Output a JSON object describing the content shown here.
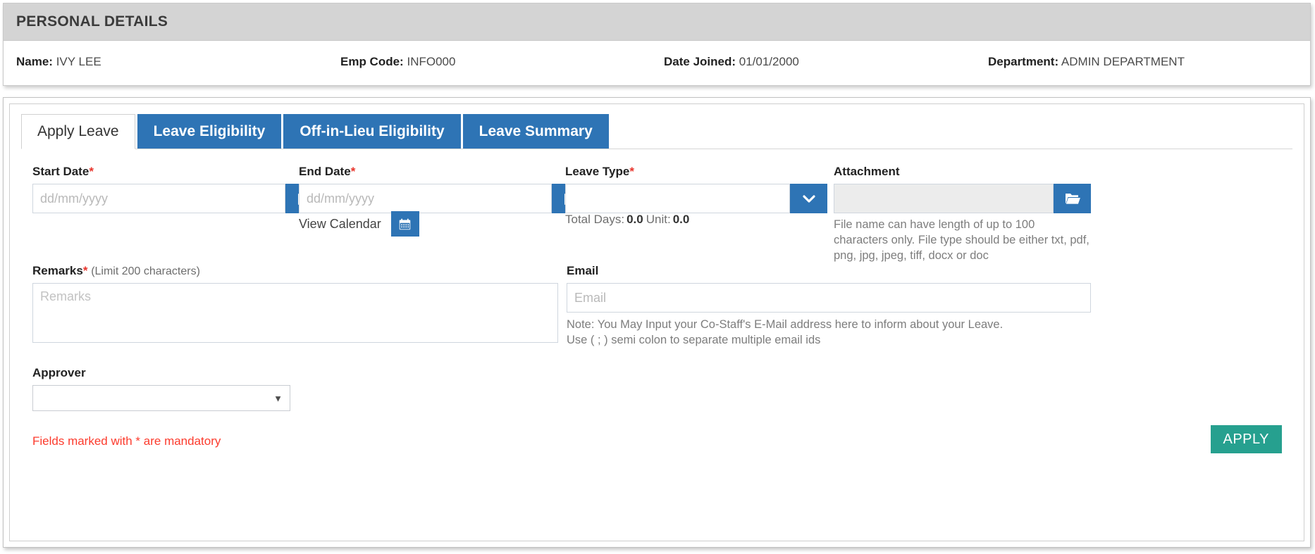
{
  "personal_details": {
    "title": "PERSONAL DETAILS",
    "fields": [
      {
        "label": "Name:",
        "value": "IVY LEE"
      },
      {
        "label": "Emp Code:",
        "value": "INFO000"
      },
      {
        "label": "Date Joined:",
        "value": "01/01/2000"
      },
      {
        "label": "Department:",
        "value": "ADMIN DEPARTMENT"
      }
    ]
  },
  "tabs": [
    {
      "label": "Apply Leave",
      "active": true
    },
    {
      "label": "Leave Eligibility",
      "active": false
    },
    {
      "label": "Off-in-Lieu Eligibility",
      "active": false
    },
    {
      "label": "Leave Summary",
      "active": false
    }
  ],
  "form": {
    "start_date": {
      "label": "Start Date",
      "required_mark": "*",
      "value": "",
      "placeholder": "dd/mm/yyyy",
      "button_icon": "calendar-icon"
    },
    "end_date": {
      "label": "End Date",
      "required_mark": "*",
      "value": "",
      "placeholder": "dd/mm/yyyy",
      "button_icon": "calendar-icon"
    },
    "view_calendar": {
      "label": "View Calendar",
      "button_icon": "calendar-icon"
    },
    "leave_type": {
      "label": "Leave Type",
      "required_mark": "*",
      "value": "",
      "button_icon": "chevron-down-icon"
    },
    "totals": {
      "total_days_label": "Total Days:",
      "total_days_value": "0.0",
      "unit_label": "Unit:",
      "unit_value": "0.0"
    },
    "attachment": {
      "label": "Attachment",
      "value": "",
      "button_icon": "folder-open-icon",
      "help_text": "File name can have length of up to 100 characters only. File type should be either txt, pdf, png, jpg, jpeg, tiff, docx or doc"
    },
    "remarks": {
      "label": "Remarks",
      "required_mark": "*",
      "limit_note": "(Limit 200 characters)",
      "value": "",
      "placeholder": "Remarks"
    },
    "email": {
      "label": "Email",
      "value": "",
      "placeholder": "Email",
      "note_line1": "Note: You May Input your Co-Staff's E-Mail address here to inform about your Leave.",
      "note_line2": "Use ( ; ) semi colon to separate multiple email ids"
    },
    "approver": {
      "label": "Approver",
      "value": "",
      "caret_icon": "caret-down-icon"
    },
    "mandatory_note": "Fields marked with * are mandatory",
    "apply_button": "APPLY"
  },
  "colors": {
    "primary_blue": "#2e74b5",
    "apply_green": "#26a08f",
    "required_red": "#e8342b",
    "note_red": "#fc3b2d",
    "panel_header_gray": "#d4d4d4"
  }
}
